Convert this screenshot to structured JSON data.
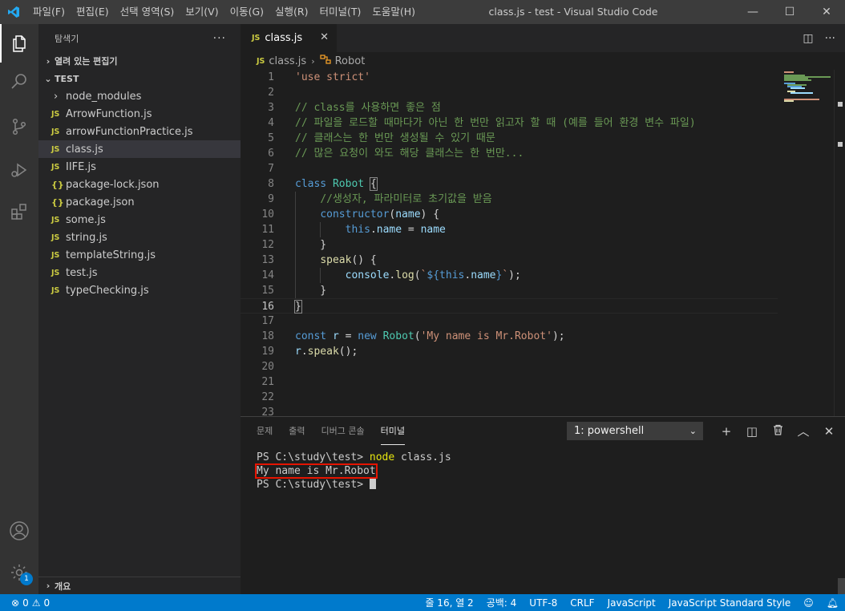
{
  "titlebar": {
    "menu": [
      "파일(F)",
      "편집(E)",
      "선택 영역(S)",
      "보기(V)",
      "이동(G)",
      "실행(R)",
      "터미널(T)",
      "도움말(H)"
    ],
    "title": "class.js - test - Visual Studio Code",
    "minimize": "—",
    "maximize": "☐",
    "close": "✕"
  },
  "colors": {
    "accent": "#007acc",
    "titlebar_bg": "#3c3c3c",
    "sidebar_bg": "#252526",
    "editor_bg": "#1e1e1e",
    "terminal_highlight_border": "#e51400"
  },
  "activitybar": {
    "icons": [
      "explorer-icon",
      "search-icon",
      "source-control-icon",
      "run-debug-icon",
      "extensions-icon",
      "account-icon",
      "manage-gear-icon"
    ],
    "manage_badge": "1"
  },
  "sidebar": {
    "header": "탐색기",
    "more": "···",
    "open_editors": "열려 있는 편집기",
    "folder": "TEST",
    "outline": "개요",
    "files": [
      {
        "icon": "›",
        "name": "node_modules"
      },
      {
        "icon": "JS",
        "name": "ArrowFunction.js"
      },
      {
        "icon": "JS",
        "name": "arrowFunctionPractice.js"
      },
      {
        "icon": "JS",
        "name": "class.js"
      },
      {
        "icon": "JS",
        "name": "IIFE.js"
      },
      {
        "icon": "{}",
        "name": "package-lock.json"
      },
      {
        "icon": "{}",
        "name": "package.json"
      },
      {
        "icon": "JS",
        "name": "some.js"
      },
      {
        "icon": "JS",
        "name": "string.js"
      },
      {
        "icon": "JS",
        "name": "templateString.js"
      },
      {
        "icon": "JS",
        "name": "test.js"
      },
      {
        "icon": "JS",
        "name": "typeChecking.js"
      }
    ]
  },
  "editor": {
    "tab": {
      "icon": "JS",
      "label": "class.js",
      "close": "✕"
    },
    "breadcrumb": {
      "icon": "JS",
      "file": "class.js",
      "symbol": "Robot"
    },
    "lines": [
      [
        [
          "s",
          "'use strict'"
        ]
      ],
      [],
      [
        [
          "c",
          "// class를 사용하면 좋은 점"
        ]
      ],
      [
        [
          "c",
          "// 파일을 로드할 때마다가 아닌 한 번만 읽고자 할 때 (예를 들어 환경 변수 파일)"
        ]
      ],
      [
        [
          "c",
          "// 클래스는 한 번만 생성될 수 있기 때문"
        ]
      ],
      [
        [
          "c",
          "// 많은 요청이 와도 해당 클래스는 한 번만..."
        ]
      ],
      [],
      [
        [
          "k",
          "class "
        ],
        [
          "cls",
          "Robot"
        ],
        [
          "p",
          " "
        ],
        [
          "bm",
          "{"
        ]
      ],
      [
        [
          "p",
          "    "
        ],
        [
          "c",
          "//생성자, 파라미터로 초기값을 받음"
        ]
      ],
      [
        [
          "p",
          "    "
        ],
        [
          "k",
          "constructor"
        ],
        [
          "p",
          "("
        ],
        [
          "v",
          "name"
        ],
        [
          "p",
          ") {"
        ]
      ],
      [
        [
          "p",
          "        "
        ],
        [
          "k",
          "this"
        ],
        [
          "p",
          "."
        ],
        [
          "v",
          "name"
        ],
        [
          "p",
          " = "
        ],
        [
          "v",
          "name"
        ]
      ],
      [
        [
          "p",
          "    }"
        ]
      ],
      [
        [
          "p",
          "    "
        ],
        [
          "fn",
          "speak"
        ],
        [
          "p",
          "() {"
        ]
      ],
      [
        [
          "p",
          "        "
        ],
        [
          "v",
          "console"
        ],
        [
          "p",
          "."
        ],
        [
          "fn",
          "log"
        ],
        [
          "p",
          "("
        ],
        [
          "s",
          "`"
        ],
        [
          "k",
          "${"
        ],
        [
          "k",
          "this"
        ],
        [
          "p",
          "."
        ],
        [
          "v",
          "name"
        ],
        [
          "k",
          "}"
        ],
        [
          "s",
          "`"
        ],
        [
          "p",
          ");"
        ]
      ],
      [
        [
          "p",
          "    }"
        ]
      ],
      [
        [
          "bm",
          "}"
        ]
      ],
      [],
      [
        [
          "k",
          "const "
        ],
        [
          "v",
          "r"
        ],
        [
          "p",
          " = "
        ],
        [
          "k",
          "new "
        ],
        [
          "cls",
          "Robot"
        ],
        [
          "p",
          "("
        ],
        [
          "s",
          "'My name is Mr.Robot'"
        ],
        [
          "p",
          ");"
        ]
      ],
      [
        [
          "v",
          "r"
        ],
        [
          "p",
          "."
        ],
        [
          "fn",
          "speak"
        ],
        [
          "p",
          "();"
        ]
      ],
      [],
      [],
      [],
      []
    ],
    "current_line": 16
  },
  "panel": {
    "tabs": [
      "문제",
      "출력",
      "디버그 콘솔",
      "터미널"
    ],
    "active_tab": "터미널",
    "terminal_select": "1: powershell",
    "actions": [
      "+",
      "◫",
      "🗑",
      "︿",
      "✕"
    ],
    "terminal": {
      "prompt1": "PS C:\\study\\test> ",
      "cmd_node": "node",
      "cmd_arg": " class.js",
      "output": "My name is Mr.Robot",
      "prompt2": "PS C:\\study\\test> "
    }
  },
  "statusbar": {
    "errors": "0",
    "warnings": "0",
    "position": "줄 16, 열 2",
    "spaces": "공백: 4",
    "encoding": "UTF-8",
    "eol": "CRLF",
    "language": "JavaScript",
    "style": "JavaScript Standard Style"
  }
}
